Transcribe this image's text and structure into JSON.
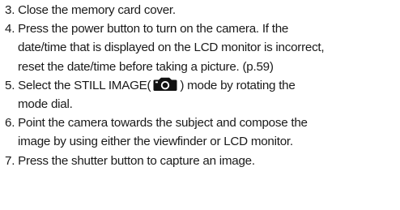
{
  "steps": [
    {
      "lines": [
        "3. Close the memory card cover."
      ]
    },
    {
      "lines": [
        "4. Press the power button to turn on the camera. If the",
        "date/time that is displayed on the LCD monitor is incorrect,",
        "reset the date/time before taking a picture. (p.59)"
      ]
    },
    {
      "line1_before_icon": "5. Select the STILL IMAGE(",
      "icon": "camera-icon",
      "line1_after_icon": ") mode by rotating the",
      "line2": "mode dial."
    },
    {
      "lines": [
        "6. Point the camera towards the subject and compose the",
        "image by using either the viewfinder or LCD monitor."
      ]
    },
    {
      "lines": [
        "7. Press the shutter button to capture an image."
      ]
    }
  ]
}
